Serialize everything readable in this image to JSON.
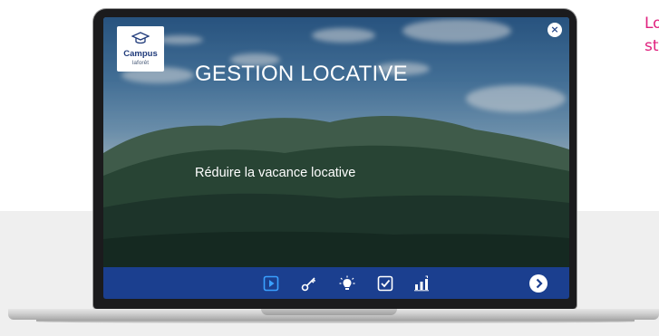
{
  "side_text": {
    "line1": "Lo",
    "line2": "st"
  },
  "slide": {
    "logo": {
      "main": "Campus",
      "sub": "laforêt"
    },
    "close_label": "×",
    "title": "GESTION LOCATIVE",
    "subtitle": "Réduire la vacance locative"
  },
  "navbar": {
    "icons": [
      "play-icon",
      "key-icon",
      "lightbulb-icon",
      "checkbox-icon",
      "chart-icon"
    ],
    "next": "chevron-right-icon"
  },
  "colors": {
    "navbar": "#1b3f8f",
    "active_icon": "#3aa0ff",
    "icon": "#ffffff",
    "accent_text": "#e0217e"
  }
}
